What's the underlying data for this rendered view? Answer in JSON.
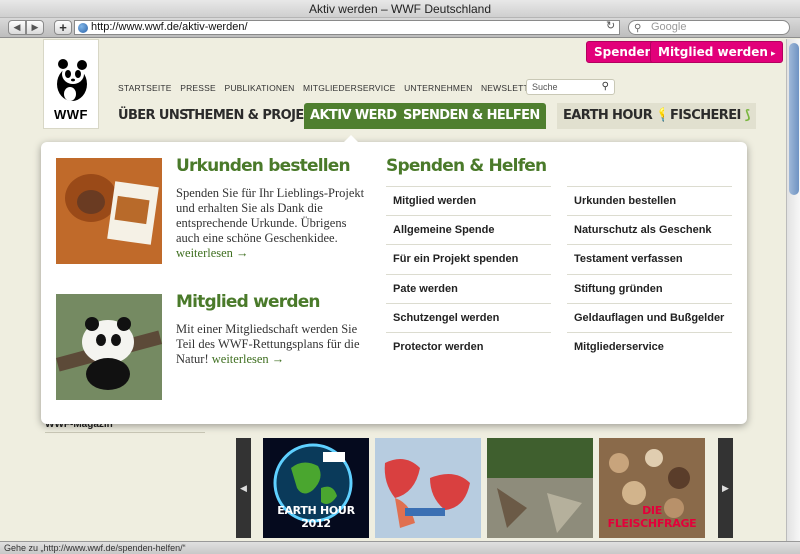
{
  "browser": {
    "window_title": "Aktiv werden – WWF Deutschland",
    "url": "http://www.wwf.de/aktiv-werden/",
    "search_placeholder": "Google",
    "status_text": "Gehe zu „http://www.wwf.de/spenden-helfen/“",
    "add_symbol": "+"
  },
  "header": {
    "logo_text": "WWF",
    "top_buttons": [
      "Spenden",
      "Mitglied werden"
    ],
    "meta_nav": [
      "STARTSEITE",
      "PRESSE",
      "PUBLIKATIONEN",
      "MITGLIEDERSERVICE",
      "UNTERNEHMEN",
      "NEWSLETTER"
    ],
    "search_placeholder": "Suche",
    "main_nav": [
      "ÜBER UNS",
      "THEMEN & PROJEKTE",
      "AKTIV WERDEN",
      "SPENDEN & HELFEN",
      "EARTH HOUR",
      "FISCHEREI"
    ]
  },
  "dropdown": {
    "features": [
      {
        "title": "Urkunden bestellen",
        "text": "Spenden Sie für Ihr Lieblings-Projekt und erhalten Sie als Dank die entsprechende Urkunde. Übrigens auch eine schöne Geschenkidee.",
        "more": "weiterlesen →"
      },
      {
        "title": "Mitglied werden",
        "text": "Mit einer Mitgliedschaft werden Sie Teil des WWF-Rettungsplans für die Natur!",
        "more": "weiterlesen →"
      }
    ],
    "column_title": "Spenden & Helfen",
    "left_links": [
      "Mitglied werden",
      "Allgemeine Spende",
      "Für ein Projekt spenden",
      "Pate werden",
      "Schutzengel werden",
      "Protector werden"
    ],
    "right_links": [
      "Urkunden bestellen",
      "Naturschutz als Geschenk",
      "Testament verfassen",
      "Stiftung gründen",
      "Geldauflagen und Bußgelder",
      "Mitgliederservice"
    ]
  },
  "below": {
    "section_label": "WWF-Magazin",
    "cards": [
      "EARTH HOUR 2012",
      "",
      "",
      "DIE FLEISCHFRAGE"
    ]
  }
}
